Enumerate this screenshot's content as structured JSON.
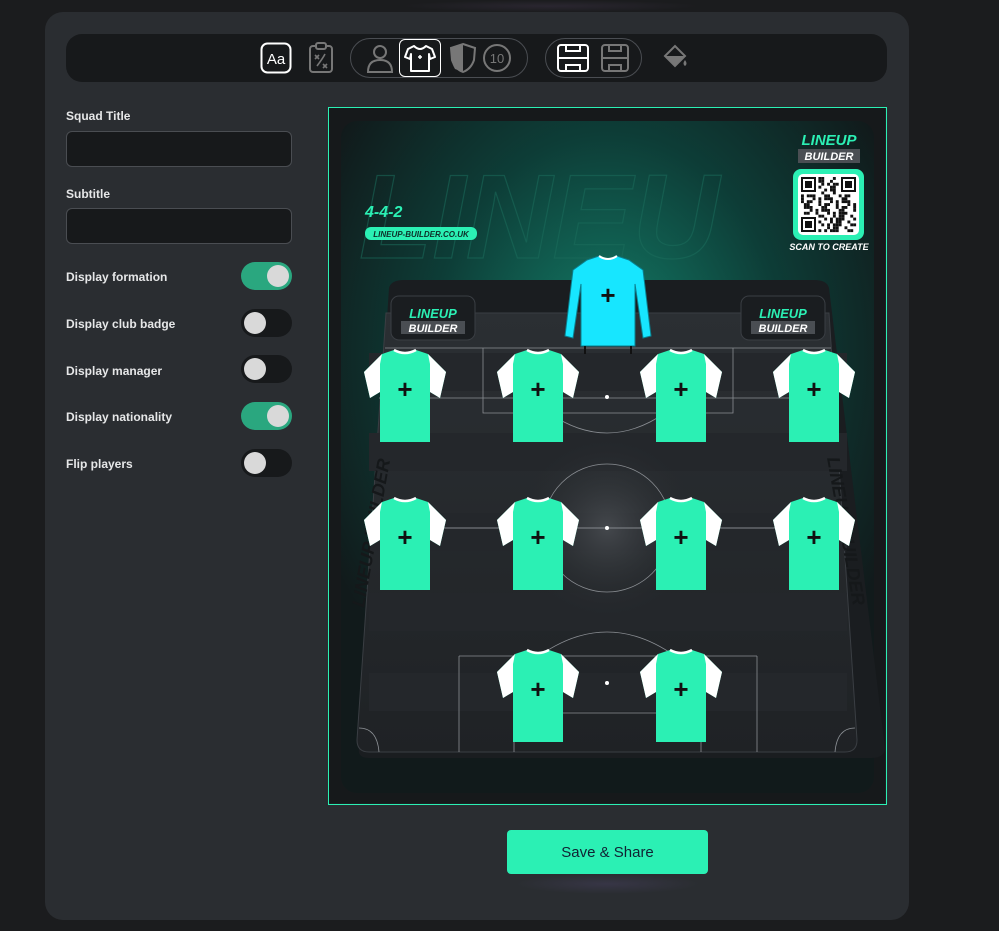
{
  "toolbar": {
    "icons": [
      "text-style-icon",
      "tactics-board-icon",
      "player-icon",
      "kit-icon",
      "badge-icon",
      "number-icon",
      "pitch-full-icon",
      "pitch-half-icon",
      "paint-bucket-icon"
    ],
    "active_icon": "kit-icon",
    "number_glyph": "10",
    "text_glyph": "Aa"
  },
  "form": {
    "squad_title_label": "Squad Title",
    "squad_title_value": "",
    "subtitle_label": "Subtitle",
    "subtitle_value": "",
    "toggles": [
      {
        "label": "Display formation",
        "on": true
      },
      {
        "label": "Display club badge",
        "on": false
      },
      {
        "label": "Display manager",
        "on": false
      },
      {
        "label": "Display nationality",
        "on": true
      },
      {
        "label": "Flip players",
        "on": false
      }
    ]
  },
  "preview": {
    "formation": "4-4-2",
    "website": "LINEUP-BUILDER.CO.UK",
    "logo_line1": "LINEUP",
    "logo_line2": "BUILDER",
    "scan_text": "SCAN TO CREATE",
    "side_text": "LINEUP BUILDER",
    "shirt_mark": "+",
    "colors": {
      "accent": "#2bf0b4",
      "keeper_shirt": "#17e6ff",
      "outfield_shirt": "#2bf0b4",
      "sleeve": "#ffffff"
    }
  },
  "actions": {
    "save_label": "Save & Share"
  }
}
